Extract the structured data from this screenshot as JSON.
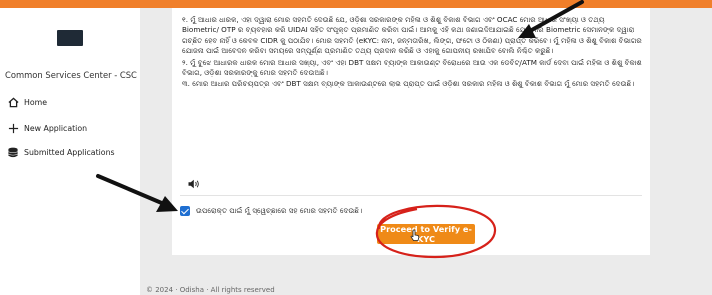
{
  "colors": {
    "accent": "#f07f2a",
    "button": "#ef8a17",
    "checkbox": "#1f6fd1",
    "annotation_red": "#d6211a"
  },
  "sidebar": {
    "title": "Common Services Center - CSC",
    "items": [
      {
        "label": "Home",
        "icon": "home-icon"
      },
      {
        "label": "New Application",
        "icon": "plus-icon"
      },
      {
        "label": "Submitted Applications",
        "icon": "database-icon"
      }
    ]
  },
  "declaration": {
    "para1": "୧. ମୁଁ ଆଧାର ଧାରକ, ଏହା ଦ୍ୱାରା ମୋର ସହମତି ଦେଉଛି ଯେ, ଓଡ଼ିଶା ସରକାରଙ୍କ ମହିଳା ଓ ଶିଶୁ ବିକାଶ ବିଭାଗ ଏବଂ OCAC ମୋର ଆଧାର ସଂଖ୍ୟା ଓ ତଥ୍ୟ Biometric/ OTP ର ବ୍ୟବହାର କରି UIDAI ସହିତ ସଂପୃକ୍ତ ପ୍ରମାଣିତ କରିବା ପାଇଁ। ଆମକୁ ଏହି କଥା ଜଣାଇଦିଆଯାଇଛି ଯେ ମୋର Biometric ସେମାନଙ୍କ ଦ୍ୱାରା ଗଚ୍ଛିତ ହେବ ନାହିଁ ଓ କେବଳ CIDR କୁ ପଠାଯିବ। ମୋର ସହମତି (eKYC: ନାମ, ଜନ୍ମତାରିଖ, ଲିଙ୍ଗ, ଫଟୋ ଓ ଠିକଣା) ପ୍ରାପ୍ତ କରିବେ। ମୁଁ ମହିଳା ଓ ଶିଶୁ ବିକାଶ ବିଭାଗର ଯୋଜନା ପାଇଁ ଆବେଦନ କରିବା ସମୟରେ ସମ୍ପୂର୍ଣ୍ଣ ପ୍ରମାଣିତ ତଥ୍ୟ ପ୍ରଦାନ କରିଛି ଓ ଏହାକୁ ଗୋପନୀୟ ରଖାଯିବ ବୋଲି ନିଶ୍ଚିତ କରୁଛି।",
    "para2": "୨. ମୁଁ ବୁଝେ ଆଧାରକ ଧାରକ ମୋର ଆଧାର ସଖ୍ୟା, ଏବଂ ଏହା DBT ସକ୍ଷମ ବ୍ୟାଙ୍କ ଆକାଉଣ୍ଟ ବିରୋଧରେ ଆଉ ଏକ ଡେବିଟ୍/ATM କାର୍ଡ ଦେବା ପାଇଁ ମହିଳା ଓ ଶିଶୁ ବିକାଶ ବିଭାଗ, ଓଡ଼ିଶା ସରକାରଙ୍କୁ ମୋର ସହମତି ଦେଉଅଛି।",
    "para3": "୩. ମୋର ଆଧାର ପରିଚୟପତ୍ର ଏବଂ DBT ସକ୍ଷମ ବ୍ୟାଙ୍କ ଆକାଉଣ୍ଟରେ ଲାଭ ପ୍ରାପ୍ତ ପାଇଁ ଓଡ଼ିଶା ସରକାର ମହିଳା ଓ ଶିଶୁ ବିକାଶ ବିଭାଗ ମୁଁ ମୋର ସହମତି ଦେଉଛି।"
  },
  "consent": {
    "label": "ଉପରୋକ୍ତ ପାଇଁ ମୁଁ ସ୍ୱେଚ୍ଛାରେ ସହ ମୋର ସହମତି ଦେଉଛି।",
    "checked": true
  },
  "verify_button": {
    "label": "Proceed to Verify e-KYC"
  },
  "footer": {
    "text": "© 2024 · Odisha · All rights reserved"
  }
}
